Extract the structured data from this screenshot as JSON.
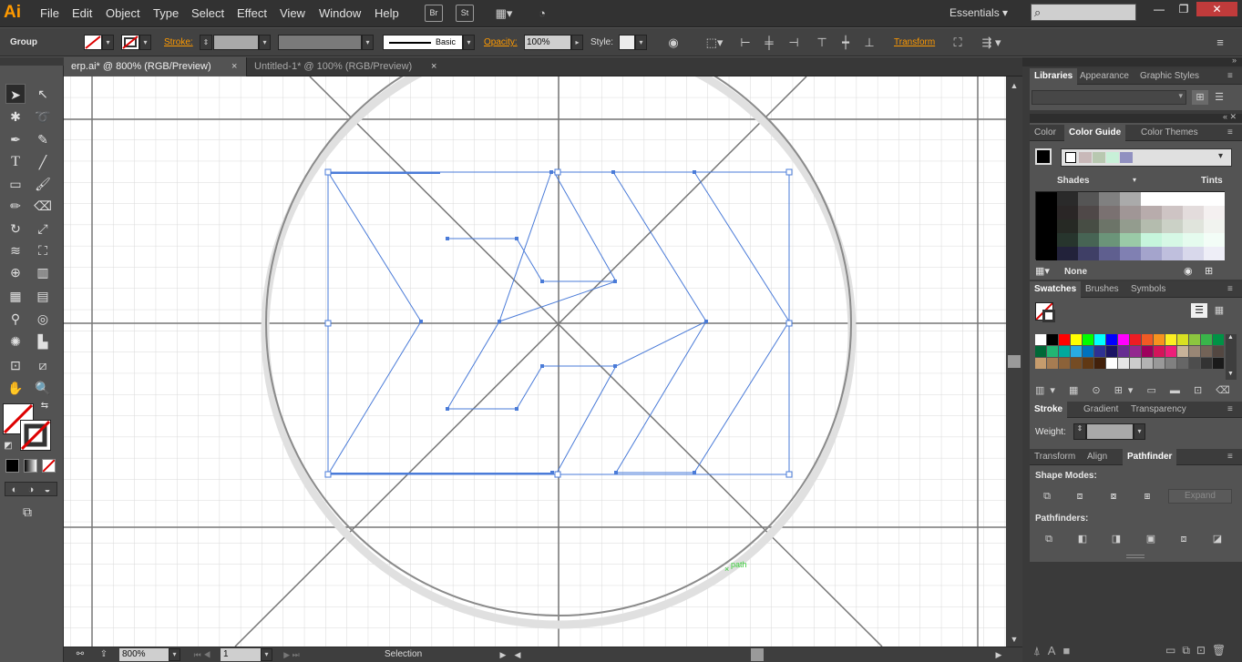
{
  "app": {
    "logo": "Ai",
    "workspace": "Essentials"
  },
  "menu": [
    "File",
    "Edit",
    "Object",
    "Type",
    "Select",
    "Effect",
    "View",
    "Window",
    "Help"
  ],
  "bridge_btns": [
    "Br",
    "St"
  ],
  "control": {
    "selection": "Group",
    "stroke_label": "Stroke:",
    "style_label": "Basic",
    "opacity_label": "Opacity:",
    "opacity_value": "100%",
    "style_field_label": "Style:",
    "transform_label": "Transform"
  },
  "doc_tabs": [
    {
      "label": "erp.ai* @ 800% (RGB/Preview)",
      "active": true
    },
    {
      "label": "Untitled-1* @ 100% (RGB/Preview)",
      "active": false
    }
  ],
  "canvas": {
    "path_hint": "path"
  },
  "status": {
    "zoom": "800%",
    "artboard": "1",
    "tool": "Selection"
  },
  "panels": {
    "libraries_tabs": [
      "Libraries",
      "Appearance",
      "Graphic Styles"
    ],
    "color_tabs": [
      "Color",
      "Color Guide",
      "Color Themes"
    ],
    "shades_label": "Shades",
    "tints_label": "Tints",
    "none_label": "None",
    "swatch_tabs": [
      "Swatches",
      "Brushes",
      "Symbols"
    ],
    "stroke_tabs": [
      "Stroke",
      "Gradient",
      "Transparency"
    ],
    "weight_label": "Weight:",
    "path_tabs": [
      "Transform",
      "Align",
      "Pathfinder"
    ],
    "shape_modes_label": "Shape Modes:",
    "pathfinders_label": "Pathfinders:",
    "expand_label": "Expand"
  },
  "colors": {
    "accent": "#ff9a00",
    "selection": "#4a7bd8",
    "guide": "#777777",
    "grid": "#dddddd",
    "canvas": "#ffffff"
  },
  "guide_harmony": [
    "#ffffff",
    "#c8b8b8",
    "#b8c8b0",
    "#c8f0d8",
    "#9090c0"
  ],
  "swatch_colors": [
    "#ffffff",
    "#000000",
    "#ff0000",
    "#ffff00",
    "#00ff00",
    "#00ffff",
    "#0000ff",
    "#ff00ff",
    "#ed1c24",
    "#f15a24",
    "#f7931e",
    "#fcee21",
    "#d9e021",
    "#8cc63f",
    "#39b54a",
    "#009245",
    "#006837",
    "#22b573",
    "#00a99d",
    "#29abe2",
    "#0071bc",
    "#2e3192",
    "#1b1464",
    "#662d91",
    "#93278f",
    "#9e005d",
    "#d4145a",
    "#ed1e79",
    "#c7b299",
    "#998675",
    "#736357",
    "#534741",
    "#c69c6d",
    "#a67c52",
    "#8c6239",
    "#754c24",
    "#603813",
    "#42210b",
    "#ffffff",
    "#e6e6e6",
    "#cccccc",
    "#b3b3b3",
    "#999999",
    "#808080",
    "#666666",
    "#4d4d4d",
    "#333333",
    "#1a1a1a"
  ]
}
